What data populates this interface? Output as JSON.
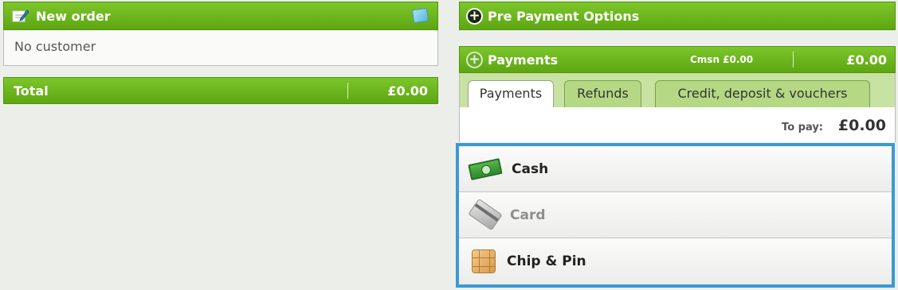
{
  "order": {
    "title": "New order",
    "customer_text": "No customer",
    "total_label": "Total",
    "total_amount": "£0.00"
  },
  "prepayment": {
    "title": "Pre Payment Options"
  },
  "payments": {
    "title": "Payments",
    "commission": "Cmsn £0.00",
    "amount": "£0.00",
    "tabs": [
      {
        "label": "Payments",
        "active": true
      },
      {
        "label": "Refunds",
        "active": false
      },
      {
        "label": "Credit, deposit & vouchers",
        "active": false
      }
    ],
    "to_pay_label": "To pay:",
    "to_pay_amount": "£0.00",
    "methods": [
      {
        "label": "Cash",
        "icon": "cash-icon",
        "enabled": true
      },
      {
        "label": "Card",
        "icon": "card-icon",
        "enabled": false
      },
      {
        "label": "Chip & Pin",
        "icon": "chip-pin-icon",
        "enabled": true
      }
    ]
  },
  "colors": {
    "green_header": "#6bb51e",
    "selection_outline": "#3b99d4",
    "background": "#ecefe9"
  }
}
